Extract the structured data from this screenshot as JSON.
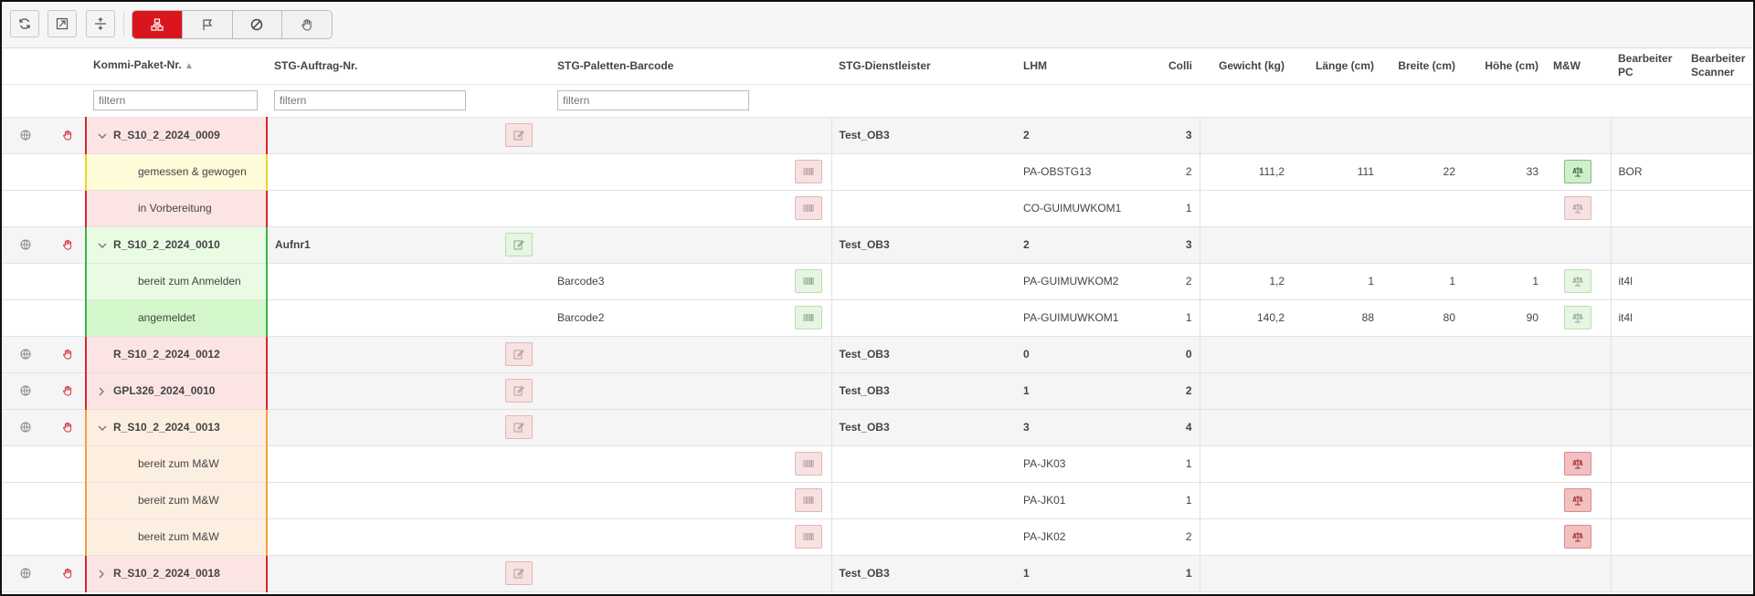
{
  "toolbar": {
    "buttons": [
      {
        "name": "refresh-button",
        "icon": "refresh-icon"
      },
      {
        "name": "resize-button",
        "icon": "resize-icon"
      },
      {
        "name": "split-button",
        "icon": "split-icon"
      }
    ],
    "mode_buttons": [
      {
        "name": "mode-package-button",
        "icon": "package-tree-icon",
        "active": true
      },
      {
        "name": "mode-flag-button",
        "icon": "flag-icon",
        "active": false
      },
      {
        "name": "mode-block-button",
        "icon": "block-icon",
        "active": false
      },
      {
        "name": "mode-hand-button",
        "icon": "hand-icon",
        "active": false
      }
    ],
    "accent_color": "#d9161e"
  },
  "columns": {
    "kommi": "Kommi-Paket-Nr.",
    "auftrag": "STG-Auftrag-Nr.",
    "barcode": "STG-Paletten-Barcode",
    "dienstleister": "STG-Dienstleister",
    "lhm": "LHM",
    "colli": "Colli",
    "gewicht": "Gewicht (kg)",
    "laenge": "Länge (cm)",
    "breite": "Breite (cm)",
    "hoehe": "Höhe (cm)",
    "mw": "M&W",
    "bearbeiter_pc": "Bearbeiter PC",
    "bearbeiter_scanner": "Bearbeiter Scanner"
  },
  "filters": {
    "kommi_placeholder": "filtern",
    "auftrag_placeholder": "filtern",
    "barcode_placeholder": "filtern"
  },
  "rows": [
    {
      "type": "parent",
      "status": "red",
      "expanded": true,
      "name": "R_S10_2_2024_0009",
      "auftrag": "",
      "barcode": "",
      "dienstleister": "Test_OB3",
      "lhm": "2",
      "colli": "3",
      "hand_red": false,
      "edit_green": false
    },
    {
      "type": "child",
      "status": "yellow",
      "name": "gemessen & gewogen",
      "barcode": "",
      "lhm": "PA-OBSTG13",
      "colli": "2",
      "gewicht": "111,2",
      "laenge": "111",
      "breite": "22",
      "hoehe": "33",
      "mw": "scale-active",
      "bearbeiter_pc": "BOR",
      "barcode_green": false
    },
    {
      "type": "child",
      "status": "red",
      "name": "in Vorbereitung",
      "barcode": "",
      "lhm": "CO-GUIMUWKOM1",
      "colli": "1",
      "gewicht": "",
      "laenge": "",
      "breite": "",
      "hoehe": "",
      "mw": "scale-faint-red",
      "bearbeiter_pc": "",
      "barcode_green": false
    },
    {
      "type": "parent",
      "status": "green",
      "expanded": true,
      "name": "R_S10_2_2024_0010",
      "auftrag": "Aufnr1",
      "barcode": "",
      "dienstleister": "Test_OB3",
      "lhm": "2",
      "colli": "3",
      "hand_red": true,
      "edit_green": true
    },
    {
      "type": "child",
      "status": "green",
      "name": "bereit zum Anmelden",
      "barcode": "Barcode3",
      "lhm": "PA-GUIMUWKOM2",
      "colli": "2",
      "gewicht": "1,2",
      "laenge": "1",
      "breite": "1",
      "hoehe": "1",
      "mw": "scale-faint-green",
      "bearbeiter_pc": "it4l",
      "barcode_green": true
    },
    {
      "type": "child",
      "status": "brightgreen",
      "name": "angemeldet",
      "barcode": "Barcode2",
      "lhm": "PA-GUIMUWKOM1",
      "colli": "1",
      "gewicht": "140,2",
      "laenge": "88",
      "breite": "80",
      "hoehe": "90",
      "mw": "scale-faint-green",
      "bearbeiter_pc": "it4l",
      "barcode_green": true
    },
    {
      "type": "parent",
      "status": "red",
      "expanded": null,
      "name": "R_S10_2_2024_0012",
      "auftrag": "",
      "barcode": "",
      "dienstleister": "Test_OB3",
      "lhm": "0",
      "colli": "0",
      "hand_red": false,
      "edit_green": false
    },
    {
      "type": "parent",
      "status": "red",
      "expanded": false,
      "name": "GPL326_2024_0010",
      "auftrag": "",
      "barcode": "",
      "dienstleister": "Test_OB3",
      "lhm": "1",
      "colli": "2",
      "hand_red": false,
      "edit_green": false
    },
    {
      "type": "parent",
      "status": "orange",
      "expanded": true,
      "name": "R_S10_2_2024_0013",
      "auftrag": "",
      "barcode": "",
      "dienstleister": "Test_OB3",
      "lhm": "3",
      "colli": "4",
      "hand_red": false,
      "edit_green": false
    },
    {
      "type": "child",
      "status": "orange",
      "name": "bereit zum M&W",
      "barcode": "",
      "lhm": "PA-JK03",
      "colli": "1",
      "gewicht": "",
      "laenge": "",
      "breite": "",
      "hoehe": "",
      "mw": "scale-red",
      "bearbeiter_pc": "",
      "barcode_green": false
    },
    {
      "type": "child",
      "status": "orange",
      "name": "bereit zum M&W",
      "barcode": "",
      "lhm": "PA-JK01",
      "colli": "1",
      "gewicht": "",
      "laenge": "",
      "breite": "",
      "hoehe": "",
      "mw": "scale-red",
      "bearbeiter_pc": "",
      "barcode_green": false
    },
    {
      "type": "child",
      "status": "orange",
      "name": "bereit zum M&W",
      "barcode": "",
      "lhm": "PA-JK02",
      "colli": "2",
      "gewicht": "",
      "laenge": "",
      "breite": "",
      "hoehe": "",
      "mw": "scale-red",
      "bearbeiter_pc": "",
      "barcode_green": false
    },
    {
      "type": "parent",
      "status": "red",
      "expanded": false,
      "name": "R_S10_2_2024_0018",
      "auftrag": "",
      "barcode": "",
      "dienstleister": "Test_OB3",
      "lhm": "1",
      "colli": "1",
      "hand_red": false,
      "edit_green": false
    }
  ]
}
